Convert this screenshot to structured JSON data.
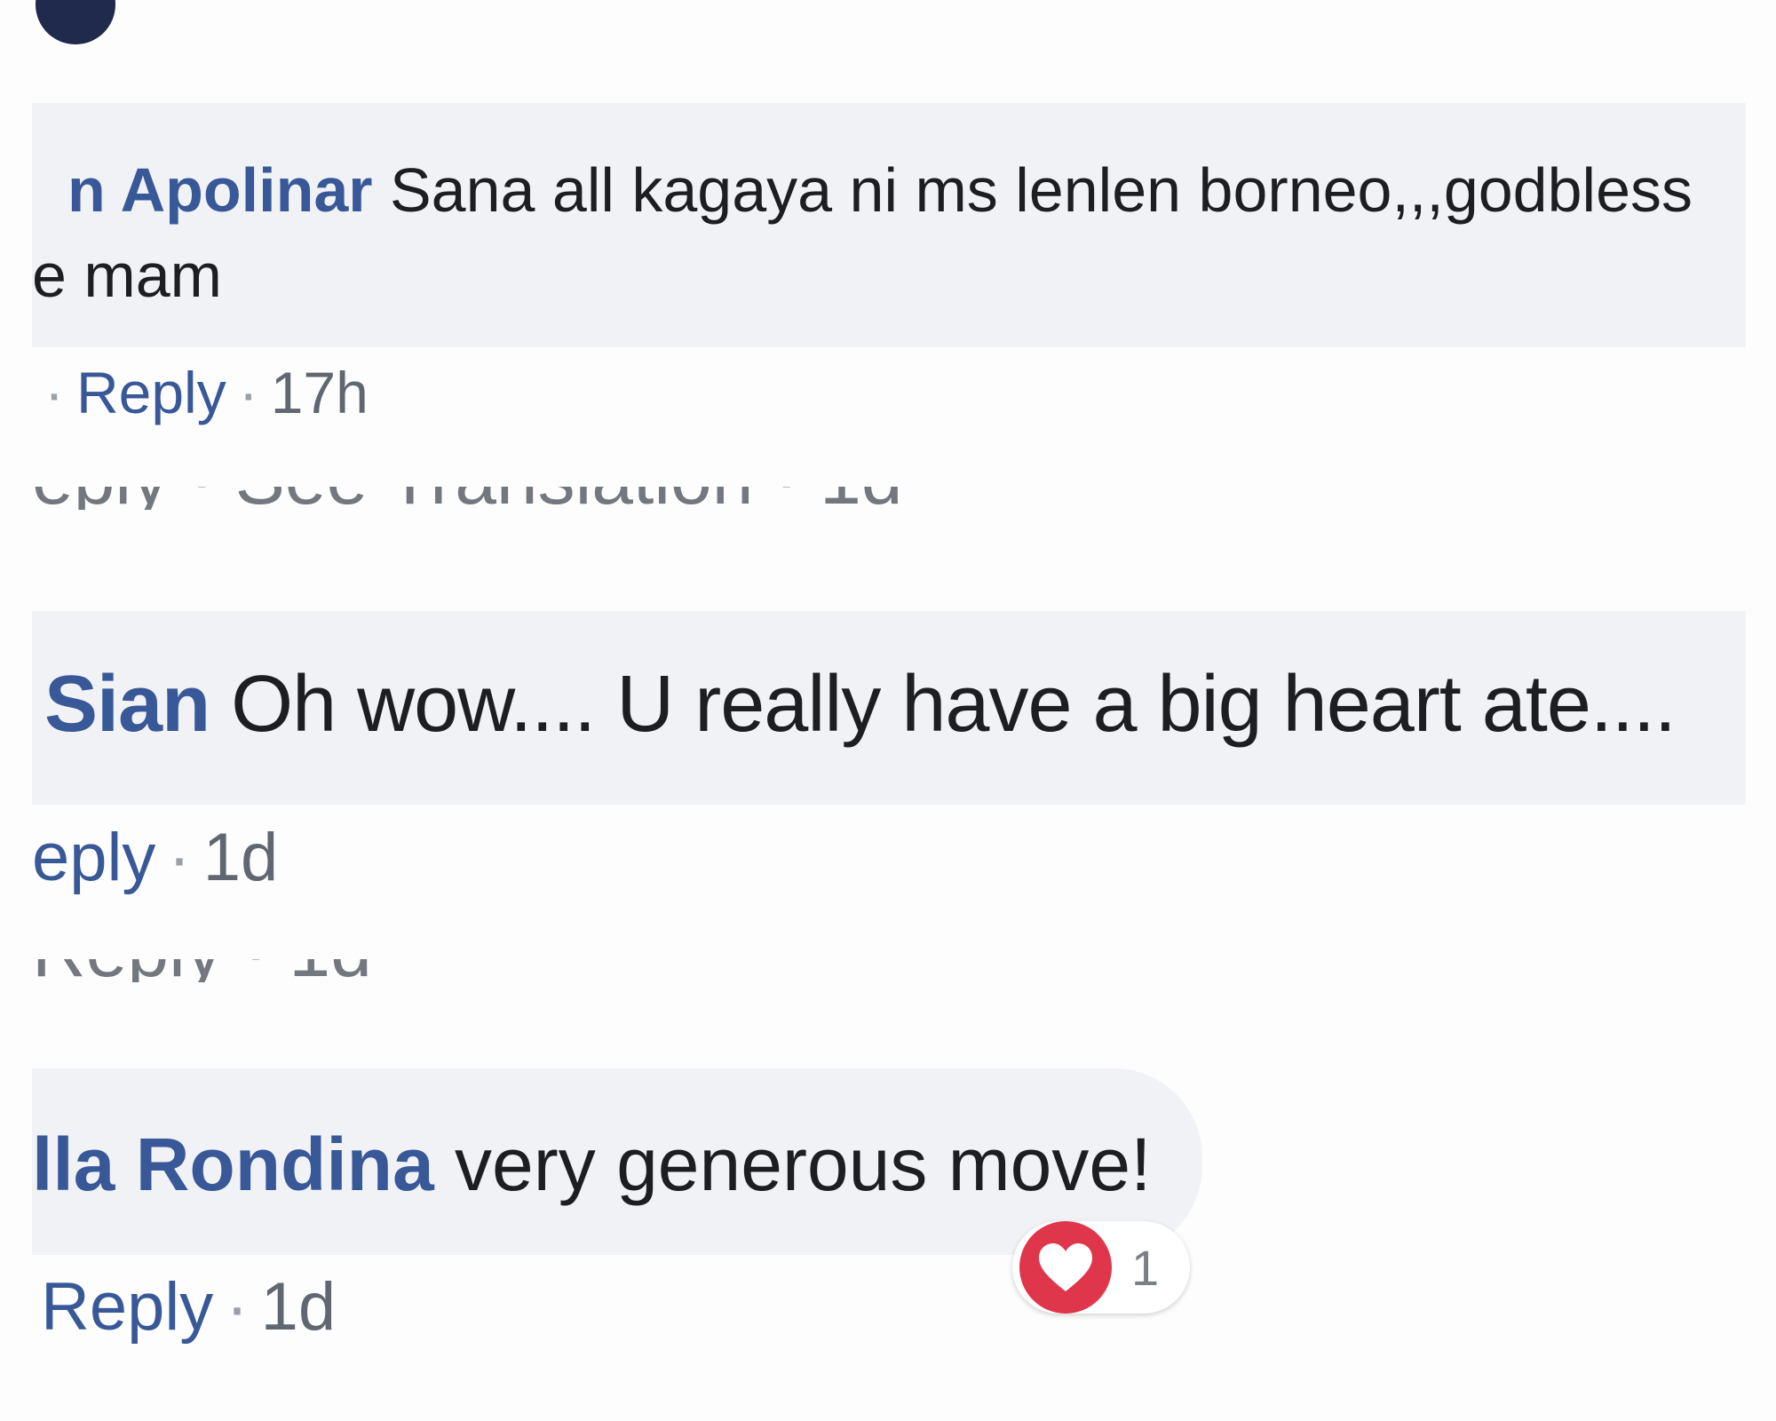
{
  "comments": [
    {
      "author": "n Apolinar",
      "text_line1": "Sana all kagaya ni ms lenlen borneo,,,godbless",
      "text_line2": "e mam",
      "actions": {
        "reply_label": "Reply",
        "separator": "·",
        "time": "17h"
      }
    },
    {
      "author": "Sian",
      "text": "Oh wow.... U really have a big heart ate....",
      "actions": {
        "reply_label": "eply",
        "separator": "·",
        "time": "1d"
      }
    },
    {
      "author": "lla Rondina",
      "text": "very generous move!",
      "actions": {
        "reply_label": "Reply",
        "separator": "·",
        "time": "1d"
      },
      "reaction": {
        "icon": "heart-icon",
        "count": "1",
        "color": "#e0364b"
      }
    }
  ],
  "ghost_rows": [
    {
      "text": "eply · See Translation · 1d"
    },
    {
      "text": "Reply · 1d"
    }
  ],
  "colors": {
    "author": "#385898",
    "bubble": "#f1f2f6",
    "meta": "#606770"
  }
}
